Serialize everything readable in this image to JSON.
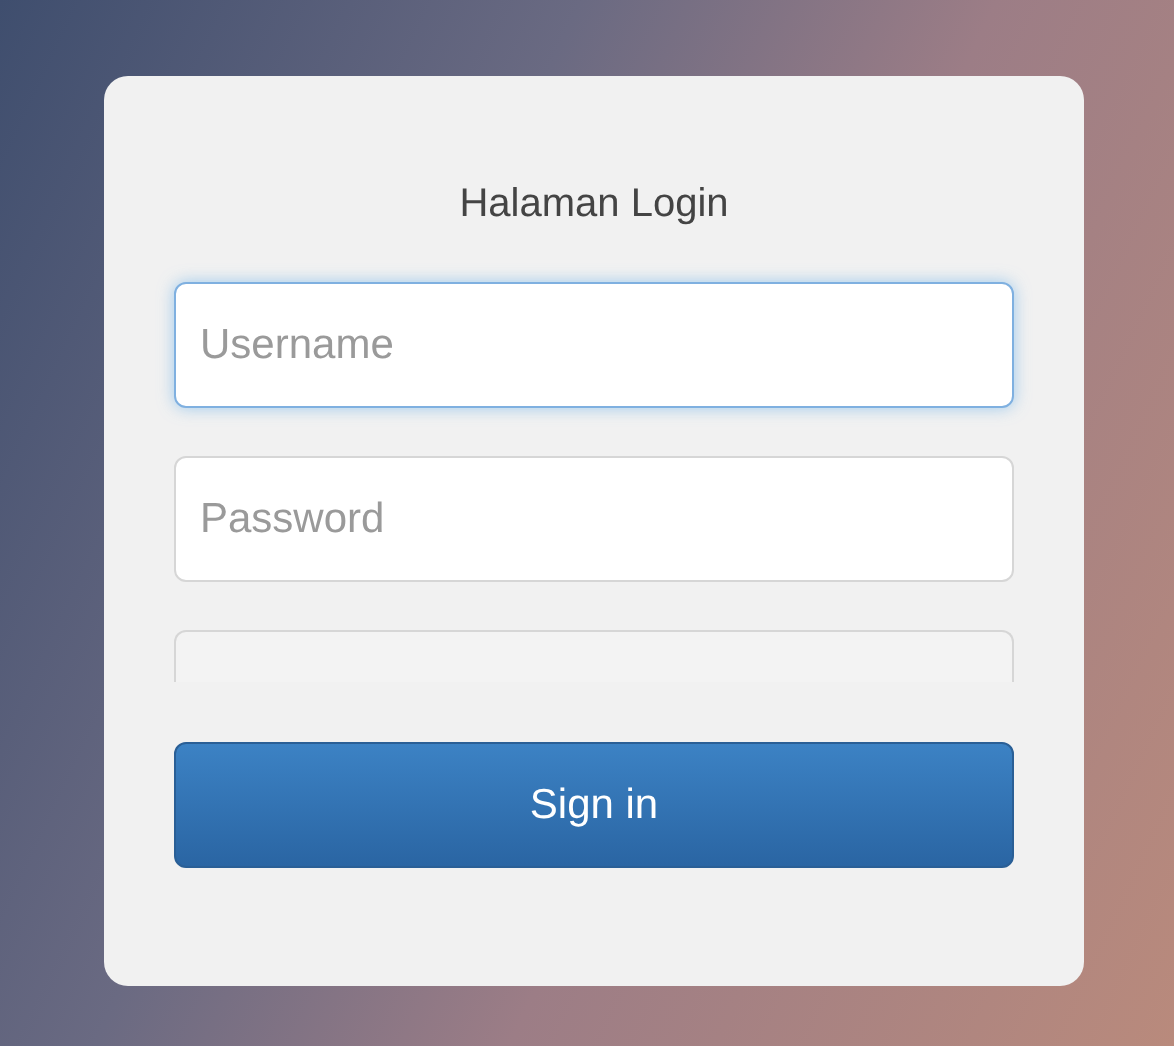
{
  "title": "Halaman Login",
  "fields": [
    {
      "kind": "input",
      "placeholder": "Username",
      "focused": true
    },
    {
      "kind": "input",
      "placeholder": "Password",
      "focused": false
    },
    {
      "kind": "cropped",
      "focused": false
    }
  ],
  "button": {
    "label": "Sign in"
  }
}
